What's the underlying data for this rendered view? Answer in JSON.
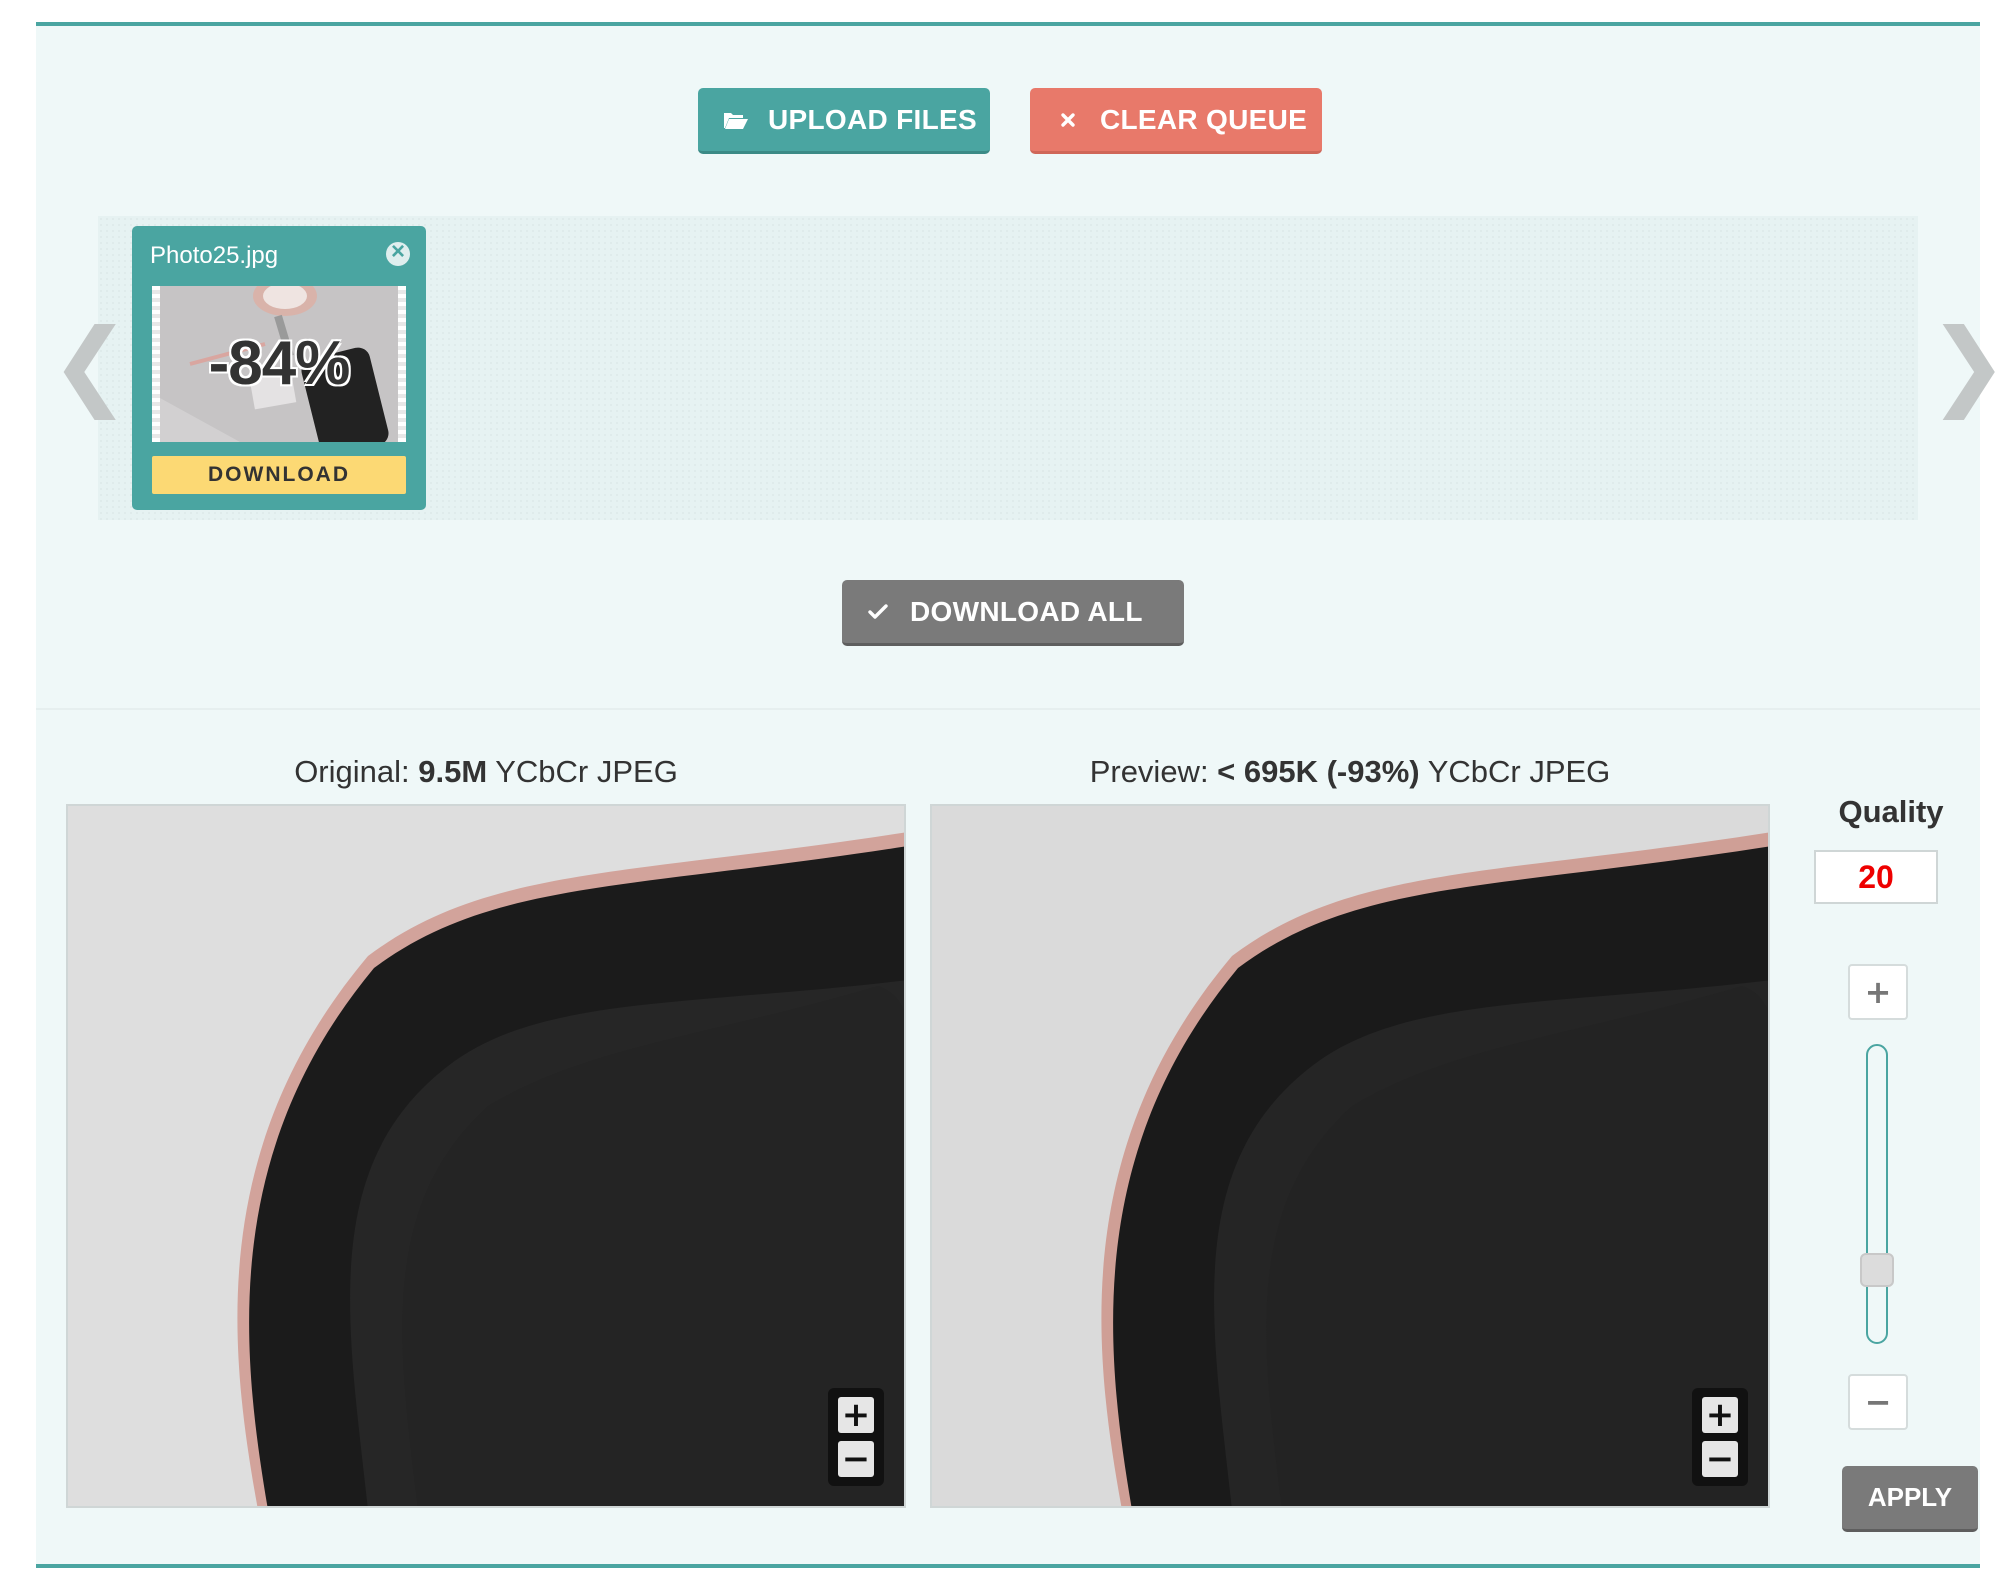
{
  "toolbar": {
    "upload_label": "UPLOAD FILES",
    "clear_label": "CLEAR QUEUE",
    "download_all_label": "DOWNLOAD ALL"
  },
  "queue": {
    "nav_prev": "❮",
    "nav_next": "❯",
    "items": [
      {
        "file_name": "Photo25.jpg",
        "reduction": "-84%",
        "download_label": "DOWNLOAD"
      }
    ]
  },
  "comparison": {
    "original": {
      "prefix": "Original: ",
      "size": "9.5M",
      "suffix": " YCbCr JPEG"
    },
    "preview": {
      "prefix": "Preview: ",
      "size": "< 695K (-93%)",
      "suffix": " YCbCr JPEG"
    },
    "zoom_in": "+",
    "zoom_out": "−"
  },
  "quality": {
    "label": "Quality",
    "value": "20",
    "value_fraction": 0.2,
    "plus": "+",
    "minus": "−",
    "apply_label": "APPLY"
  },
  "colors": {
    "accent_teal": "#4aa5a1",
    "clear_red": "#e8796a",
    "download_yellow": "#fcd974",
    "neutral_gray": "#7a7a7a",
    "quality_value_red": "#e00000"
  }
}
